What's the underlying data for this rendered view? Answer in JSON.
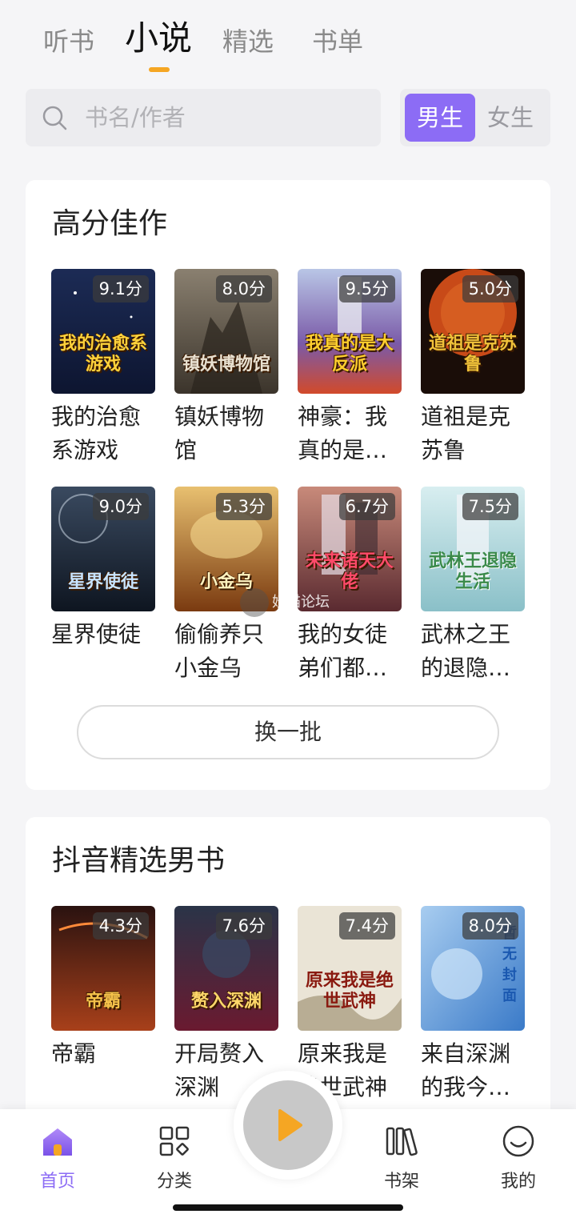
{
  "tabs": [
    {
      "label": "听书"
    },
    {
      "label": "小说"
    },
    {
      "label": "精选"
    },
    {
      "label": "书单"
    }
  ],
  "active_tab": "小说",
  "search": {
    "placeholder": "书名/作者"
  },
  "gender": {
    "male": "男生",
    "female": "女生",
    "selected": "男生"
  },
  "accent_color": "#8c6cf5",
  "tab_indicator_color": "#f5a623",
  "section1": {
    "title": "高分佳作",
    "books": [
      {
        "title": "我的治愈系游戏",
        "score": "9.1分",
        "cover_text": "我的治愈系游戏"
      },
      {
        "title": "镇妖博物馆",
        "score": "8.0分",
        "cover_text": "镇妖博物馆"
      },
      {
        "title": "神豪：我真的是…",
        "score": "9.5分",
        "cover_text": "我真的是大反派"
      },
      {
        "title": "道祖是克苏鲁",
        "score": "5.0分",
        "cover_text": "道祖是克苏鲁"
      },
      {
        "title": "星界使徒",
        "score": "9.0分",
        "cover_text": "星界使徒"
      },
      {
        "title": "偷偷养只小金乌",
        "score": "5.3分",
        "cover_text": "小金乌"
      },
      {
        "title": "我的女徒弟们都…",
        "score": "6.7分",
        "cover_text": "未来诸天大佬"
      },
      {
        "title": "武林之王的退隐…",
        "score": "7.5分",
        "cover_text": "武林王退隐生活"
      }
    ],
    "refresh_label": "换一批"
  },
  "section2": {
    "title": "抖音精选男书",
    "books": [
      {
        "title": "帝霸",
        "score": "4.3分",
        "cover_text": "帝霸"
      },
      {
        "title": "开局赘入深渊",
        "score": "7.6分",
        "cover_text": "赘入深渊"
      },
      {
        "title": "原来我是绝世武神",
        "score": "7.4分",
        "cover_text": "原来我是绝世武神"
      },
      {
        "title": "来自深渊的我今…",
        "score": "8.0分",
        "cover_text": "暂无封面"
      }
    ]
  },
  "watermark": "妖猫论坛",
  "nav": [
    {
      "label": "首页",
      "icon": "home-icon"
    },
    {
      "label": "分类",
      "icon": "category-icon"
    },
    {
      "label": "书架",
      "icon": "bookshelf-icon"
    },
    {
      "label": "我的",
      "icon": "profile-icon"
    }
  ],
  "play_icon": "play-icon"
}
